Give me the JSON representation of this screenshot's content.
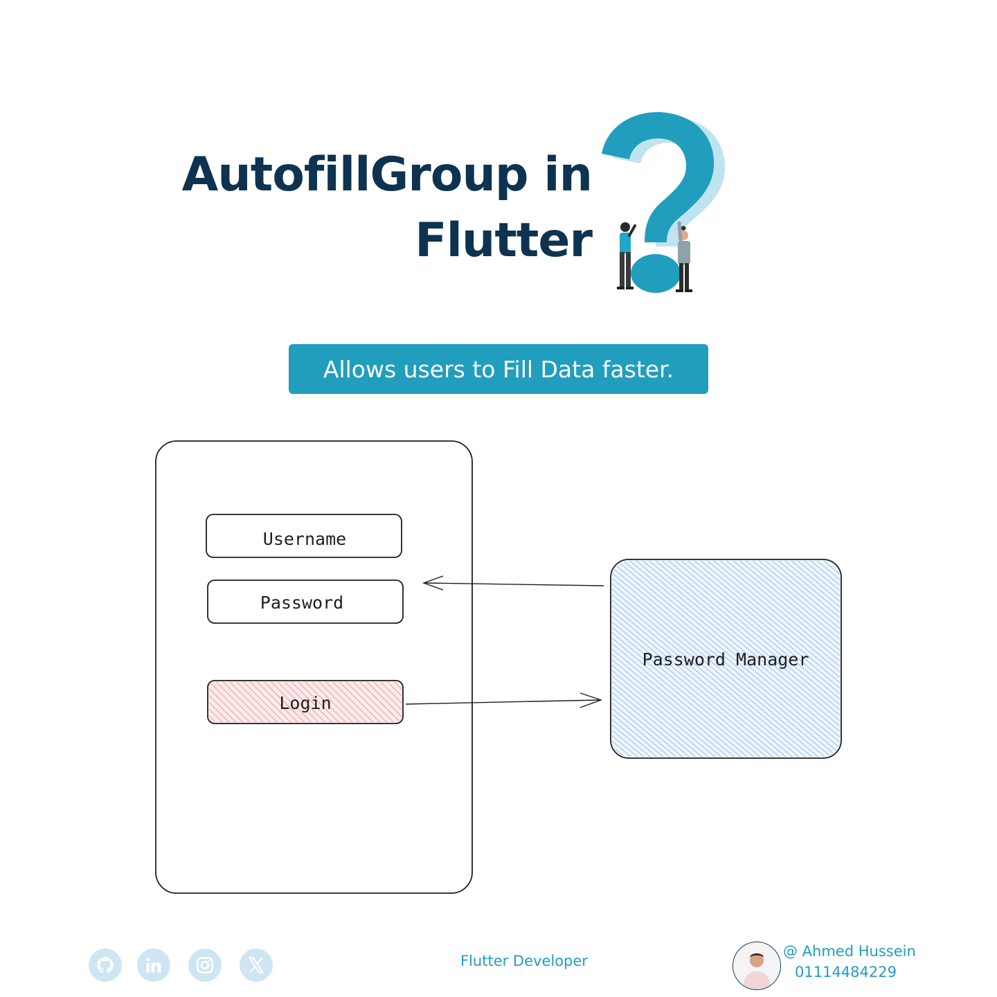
{
  "title": {
    "line1": "AutofillGroup in",
    "line2": "Flutter"
  },
  "banner": "Allows users to Fill Data faster.",
  "diagram": {
    "username_label": "Username",
    "password_label": "Password",
    "login_label": "Login",
    "manager_label": "Password Manager"
  },
  "footer": {
    "icons": [
      "github-icon",
      "linkedin-icon",
      "instagram-icon",
      "x-icon"
    ],
    "role": "Flutter Developer",
    "handle": "@ Ahmed Hussein",
    "phone": "01114484229"
  },
  "colors": {
    "navy": "#0d3350",
    "teal": "#219ebd",
    "login_hatch": "#e06b6b",
    "manager_hatch": "#4a90e2",
    "footer_icon_bg": "#cfe6f2"
  }
}
